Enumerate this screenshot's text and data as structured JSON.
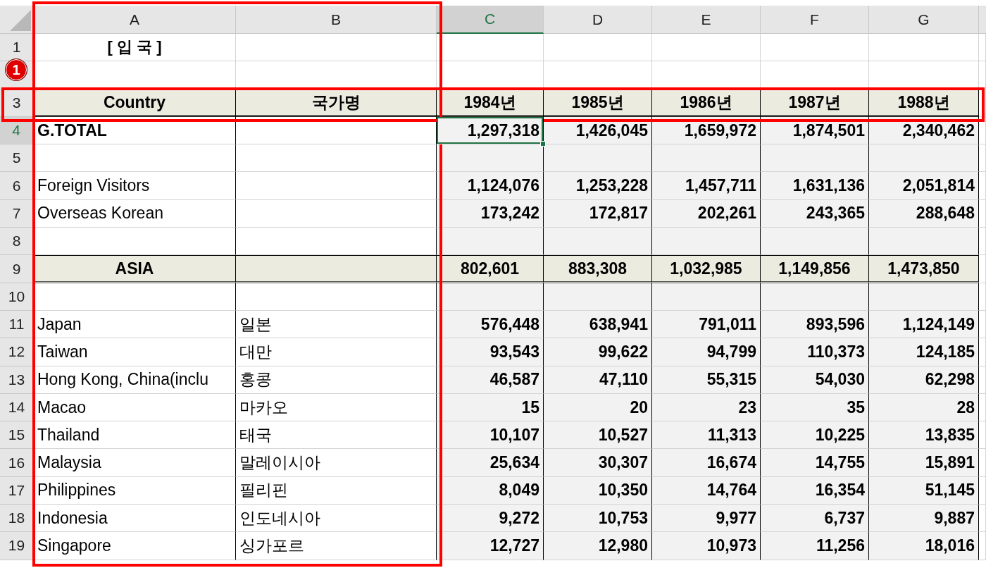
{
  "columns": [
    {
      "label": "A",
      "selected": false
    },
    {
      "label": "B",
      "selected": false
    },
    {
      "label": "C",
      "selected": true
    },
    {
      "label": "D",
      "selected": false
    },
    {
      "label": "E",
      "selected": false
    },
    {
      "label": "F",
      "selected": false
    },
    {
      "label": "G",
      "selected": false
    }
  ],
  "rows": [
    {
      "label": "1",
      "kind": "title",
      "selected": false,
      "title": "[ 입 국 ]"
    },
    {
      "kind": "spacer",
      "selected": false
    },
    {
      "label": "3",
      "kind": "header",
      "selected": false,
      "country": "Country",
      "name_ko": "국가명",
      "values": [
        "1984년",
        "1985년",
        "1986년",
        "1987년",
        "1988년"
      ]
    },
    {
      "label": "4",
      "kind": "total",
      "selected": true,
      "country": "G.TOTAL",
      "values": [
        "1,297,318",
        "1,426,045",
        "1,659,972",
        "1,874,501",
        "2,340,462"
      ]
    },
    {
      "label": "5",
      "kind": "gap",
      "selected": false
    },
    {
      "label": "6",
      "kind": "plain",
      "selected": false,
      "country": "Foreign Visitors",
      "values": [
        "1,124,076",
        "1,253,228",
        "1,457,711",
        "1,631,136",
        "2,051,814"
      ]
    },
    {
      "label": "7",
      "kind": "plain",
      "selected": false,
      "country": "Overseas Korean",
      "values": [
        "173,242",
        "172,817",
        "202,261",
        "243,365",
        "288,648"
      ]
    },
    {
      "label": "8",
      "kind": "gap",
      "selected": false
    },
    {
      "label": "9",
      "kind": "region",
      "selected": false,
      "country": "ASIA",
      "values": [
        "802,601",
        "883,308",
        "1,032,985",
        "1,149,856",
        "1,473,850"
      ]
    },
    {
      "label": "10",
      "kind": "gap",
      "selected": false
    },
    {
      "label": "11",
      "kind": "plain",
      "selected": false,
      "country": "Japan",
      "name_ko": "일본",
      "values": [
        "576,448",
        "638,941",
        "791,011",
        "893,596",
        "1,124,149"
      ]
    },
    {
      "label": "12",
      "kind": "plain",
      "selected": false,
      "country": "Taiwan",
      "name_ko": "대만",
      "values": [
        "93,543",
        "99,622",
        "94,799",
        "110,373",
        "124,185"
      ]
    },
    {
      "label": "13",
      "kind": "plain",
      "selected": false,
      "country": "Hong Kong, China(inclu",
      "name_ko": "홍콩",
      "values": [
        "46,587",
        "47,110",
        "55,315",
        "54,030",
        "62,298"
      ]
    },
    {
      "label": "14",
      "kind": "plain",
      "selected": false,
      "country": "Macao",
      "name_ko": "마카오",
      "values": [
        "15",
        "20",
        "23",
        "35",
        "28"
      ]
    },
    {
      "label": "15",
      "kind": "plain",
      "selected": false,
      "country": "Thailand",
      "name_ko": "태국",
      "values": [
        "10,107",
        "10,527",
        "11,313",
        "10,225",
        "13,835"
      ]
    },
    {
      "label": "16",
      "kind": "plain",
      "selected": false,
      "country": "Malaysia",
      "name_ko": "말레이시아",
      "values": [
        "25,634",
        "30,307",
        "16,674",
        "14,755",
        "15,891"
      ]
    },
    {
      "label": "17",
      "kind": "plain",
      "selected": false,
      "country": "Philippines",
      "name_ko": "필리핀",
      "values": [
        "8,049",
        "10,350",
        "14,764",
        "16,354",
        "51,145"
      ]
    },
    {
      "label": "18",
      "kind": "plain",
      "selected": false,
      "country": "Indonesia",
      "name_ko": "인도네시아",
      "values": [
        "9,272",
        "10,753",
        "9,977",
        "6,737",
        "9,887"
      ]
    },
    {
      "label": "19",
      "kind": "plain",
      "selected": false,
      "country": "Singapore",
      "name_ko": "싱가포르",
      "values": [
        "12,727",
        "12,980",
        "10,973",
        "11,256",
        "18,016"
      ]
    }
  ],
  "annotations": {
    "marker": "1",
    "column_frame": true,
    "row_frame": true
  }
}
